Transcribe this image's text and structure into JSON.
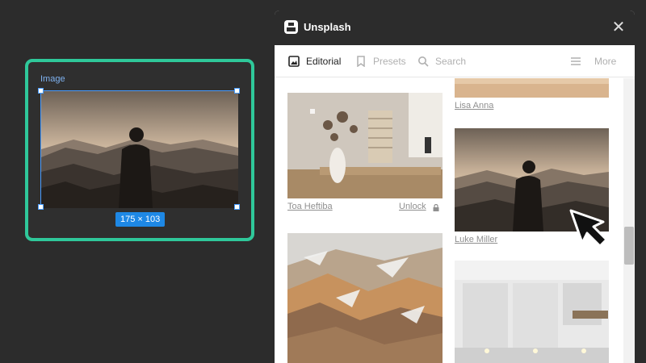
{
  "canvas": {
    "frame_label": "Image",
    "size_badge": "175 × 103"
  },
  "panel": {
    "title": "Unsplash",
    "app_icon": "unsplash-icon",
    "close_icon": "close-icon",
    "tabs": [
      {
        "label": "Editorial",
        "icon": "image-icon",
        "active": true
      },
      {
        "label": "Presets",
        "icon": "bookmark-icon",
        "active": false
      },
      {
        "label": "Search",
        "icon": "search-icon",
        "active": false
      },
      {
        "label": "More",
        "icon": "menu-icon",
        "active": false
      }
    ],
    "photos": [
      {
        "credit": "Lisa Anna",
        "subject": "wooden surface"
      },
      {
        "credit": "Toa Heftiba",
        "subject": "desk with vase and books",
        "action": "Unlock",
        "action_icon": "lock-icon"
      },
      {
        "credit": "Luke Miller",
        "subject": "man on mountain at sunset"
      },
      {
        "credit": "",
        "subject": "snowy colorful mountains"
      },
      {
        "credit": "",
        "subject": "white kitchen"
      }
    ]
  },
  "colors": {
    "selection_highlight": "#2fc89a",
    "selection_blue": "#4a9dff",
    "badge_blue": "#1e88e5",
    "background": "#2c2c2c"
  }
}
